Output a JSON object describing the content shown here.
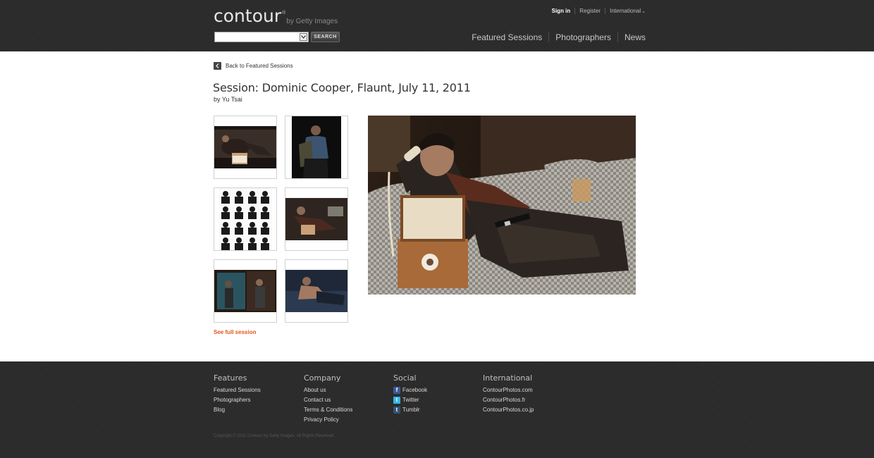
{
  "header": {
    "logo_word": "contour",
    "logo_reg": "®",
    "logo_by": "by Getty Images",
    "search_button": "SEARCH",
    "top_links": [
      "Sign in",
      "Register",
      "International"
    ],
    "nav": [
      "Featured Sessions",
      "Photographers",
      "News"
    ]
  },
  "page": {
    "back_link": "Back to Featured Sessions",
    "title": "Session: Dominic Cooper, Flaunt, July 11, 2011",
    "byline": "by Yu Tsai",
    "see_full": "See full session"
  },
  "footer": {
    "features": {
      "heading": "Features",
      "links": [
        "Featured Sessions",
        "Photographers",
        "Blog"
      ]
    },
    "company": {
      "heading": "Company",
      "links": [
        "About us",
        "Contact us",
        "Terms & Conditions",
        "Privacy Policy"
      ]
    },
    "social": {
      "heading": "Social",
      "links": [
        "Facebook",
        "Twitter",
        "Tumblr"
      ]
    },
    "international": {
      "heading": "International",
      "links": [
        "ContourPhotos.com",
        "ContourPhotos.fr",
        "ContourPhotos.co.jp"
      ]
    },
    "copyright": "Copyright © 2011 Contour by Getty Images. All Rights Reserved."
  },
  "colors": {
    "accent": "#e0561c",
    "header_bg": "#2b2b2b"
  }
}
